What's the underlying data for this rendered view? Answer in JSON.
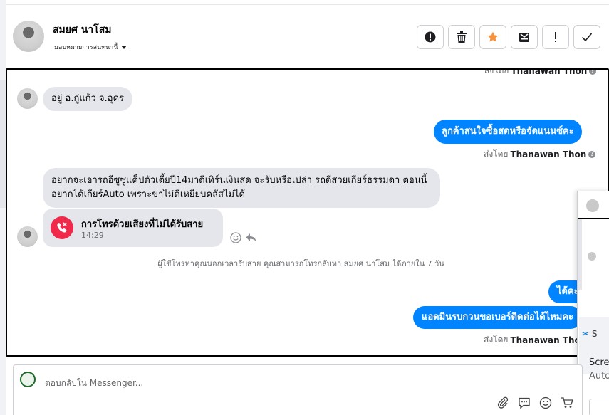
{
  "header": {
    "contact_name": "สมยศ นาโสม",
    "assign_label": "มอบหมายการสนทนานี้",
    "toolbar": [
      "alert-circle-icon",
      "trash-icon",
      "star-icon",
      "mark-inbox-icon",
      "exclamation-icon",
      "check-icon"
    ]
  },
  "chat": {
    "sent_by_prefix": "ส่งโดย",
    "sender_name": "Thanawan Thon",
    "messages": [
      {
        "dir": "in",
        "text": "อยู่ อ.กู่แก้ว จ.อุดร"
      },
      {
        "dir": "out",
        "text": "ลูกค้าสนใจซื้อสดหรือจัดแนนซ์คะ"
      },
      {
        "dir": "in",
        "text": "อยากจะเอารถอีซูซูแค็ปตัวเตี้ยปี14มาดีเทิร์นเงินสด จะรับหรือเปล่า รถดีสวยเกียร์ธรรมดา ตอนนี้อยากได้เกียร์Auto เพราะขาไม่ดีเหยียบคลัสไม่ได้"
      },
      {
        "dir": "out",
        "text": "ได้คะ"
      },
      {
        "dir": "out",
        "text": "แอดมินรบกวนขอเบอร์ติดต่อได้ไหมคะ"
      }
    ],
    "missed_call": {
      "title": "การโทรด้วยเสียงที่ไม่ได้รับสาย",
      "time": "14:29"
    },
    "system_message": "ผู้ใช้โทรหาคุณนอกเวลารับสาย คุณสามารถโทรกลับหา สมยศ นาโสม ได้ภายใน 7 วัน"
  },
  "floating": {
    "snippet": "S",
    "screen_line1": "Scree",
    "screen_line2": "Auto"
  },
  "composer": {
    "placeholder": "ตอบกลับใน Messenger...",
    "tools": [
      "attachment-icon",
      "saved-reply-icon",
      "emoji-icon",
      "product-icon"
    ]
  },
  "colors": {
    "accent": "#0084ff",
    "incoming_bubble": "#e4e6eb",
    "missed_call": "#f02849",
    "star": "#f7923b"
  }
}
